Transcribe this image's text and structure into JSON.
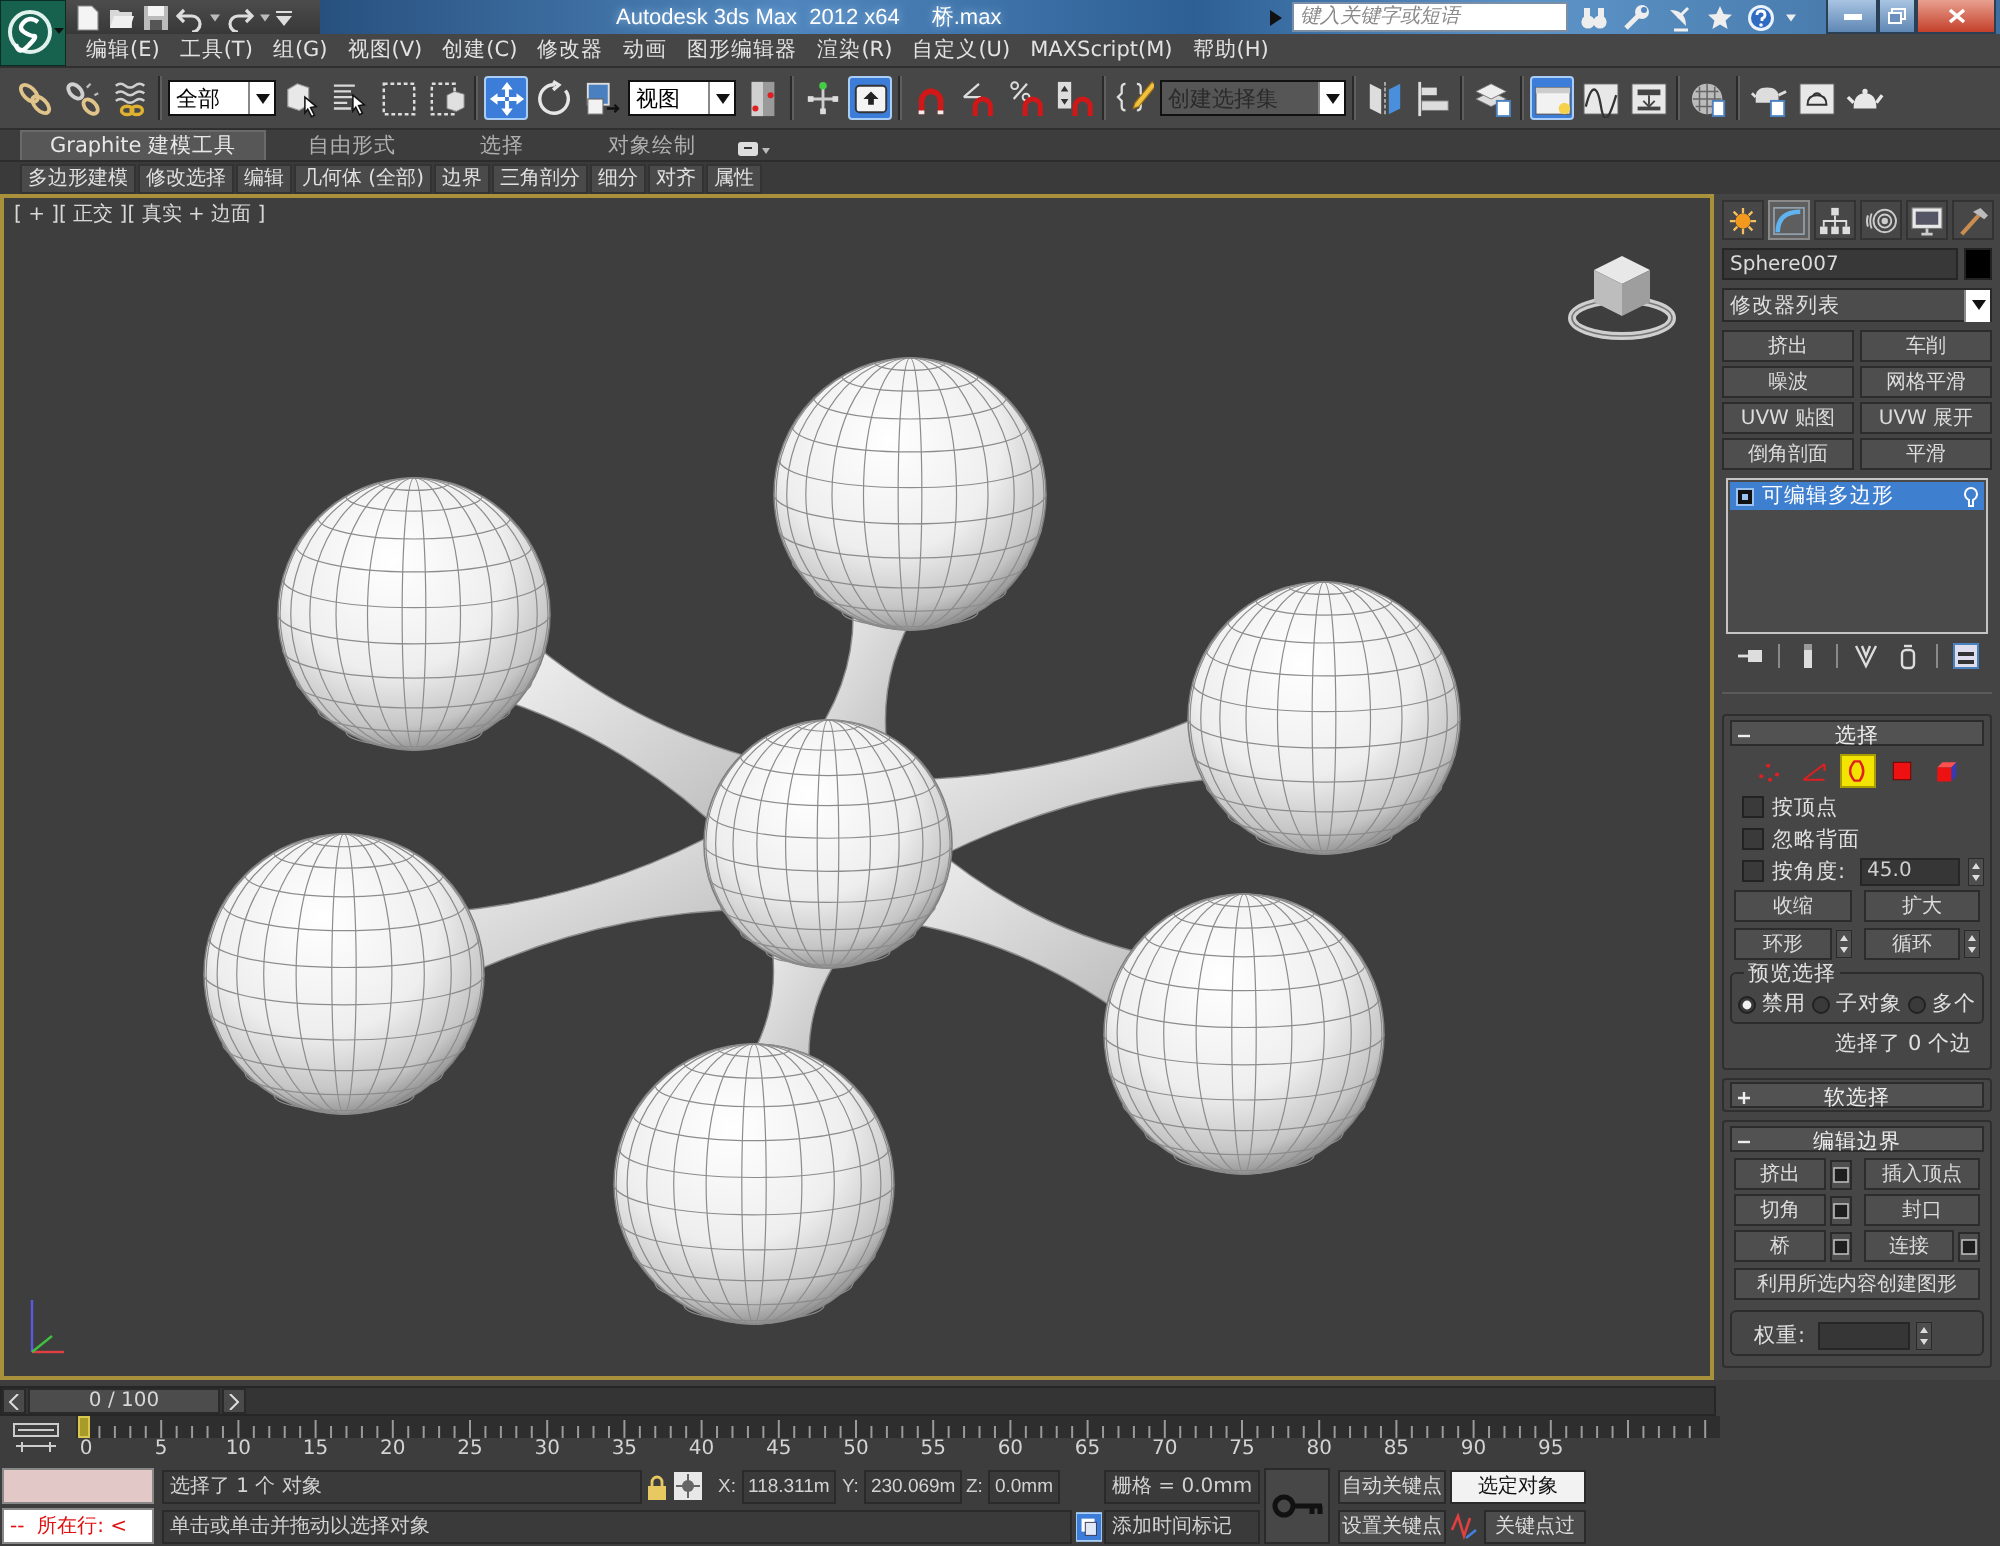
{
  "window": {
    "title": "Autodesk 3ds Max  2012 x64",
    "file": "桥.max"
  },
  "info_center": {
    "placeholder": "键入关键字或短语"
  },
  "menu": [
    "编辑(E)",
    "工具(T)",
    "组(G)",
    "视图(V)",
    "创建(C)",
    "修改器",
    "动画",
    "图形编辑器",
    "渲染(R)",
    "自定义(U)",
    "MAXScript(M)",
    "帮助(H)"
  ],
  "main_toolbar": {
    "groups": [
      {
        "items": [
          {
            "kind": "icon",
            "selected": false
          },
          {
            "kind": "icon",
            "selected": false
          },
          {
            "kind": "icon",
            "selected": false
          }
        ]
      },
      {
        "items": [
          {
            "kind": "dropdown",
            "value": "全部"
          },
          {
            "kind": "icon",
            "selected": false
          },
          {
            "kind": "icon",
            "selected": false
          },
          {
            "kind": "icon",
            "selected": false
          },
          {
            "kind": "icon",
            "selected": false
          }
        ]
      },
      {
        "items": [
          {
            "kind": "icon",
            "selected": true
          },
          {
            "kind": "icon",
            "selected": false
          },
          {
            "kind": "icon",
            "selected": false
          },
          {
            "kind": "dropdown",
            "value": "视图"
          },
          {
            "kind": "icon",
            "selected": false
          }
        ]
      },
      {
        "items": [
          {
            "kind": "icon",
            "selected": false
          },
          {
            "kind": "icon",
            "selected": true
          }
        ]
      },
      {
        "items": [
          {
            "kind": "icon",
            "selected": false
          },
          {
            "kind": "icon",
            "selected": false
          },
          {
            "kind": "icon",
            "selected": false
          },
          {
            "kind": "icon",
            "selected": false
          }
        ]
      },
      {
        "items": [
          {
            "kind": "icon",
            "selected": false
          },
          {
            "kind": "combo",
            "placeholder": "创建选择集"
          }
        ]
      },
      {
        "items": [
          {
            "kind": "icon",
            "selected": false
          },
          {
            "kind": "icon",
            "selected": false
          }
        ]
      },
      {
        "items": [
          {
            "kind": "icon",
            "selected": false
          }
        ]
      },
      {
        "items": [
          {
            "kind": "icon",
            "selected": true
          },
          {
            "kind": "icon",
            "selected": false
          },
          {
            "kind": "icon",
            "selected": false
          }
        ]
      },
      {
        "items": [
          {
            "kind": "icon",
            "selected": false
          }
        ]
      },
      {
        "items": [
          {
            "kind": "icon",
            "selected": false
          },
          {
            "kind": "icon",
            "selected": false
          },
          {
            "kind": "icon",
            "selected": false
          }
        ]
      }
    ]
  },
  "ribbon": {
    "tabs": [
      {
        "label": "Graphite 建模工具",
        "selected": true
      },
      {
        "label": "自由形式",
        "selected": false
      },
      {
        "label": "选择",
        "selected": false
      },
      {
        "label": "对象绘制",
        "selected": false
      }
    ],
    "panels": [
      "多边形建模",
      "修改选择",
      "编辑",
      "几何体 (全部)",
      "边界",
      "三角剖分",
      "细分",
      "对齐",
      "属性"
    ]
  },
  "viewport": {
    "label": "[ + ][ 正交 ][ 真实 + 边面 ]",
    "active": true
  },
  "command_panel": {
    "tabs": [
      {
        "selected": false
      },
      {
        "selected": true
      },
      {
        "selected": false
      },
      {
        "selected": false
      },
      {
        "selected": false
      },
      {
        "selected": false
      }
    ],
    "object_name": "Sphere007",
    "modifier_list": "修改器列表",
    "modifier_buttons": [
      "挤出",
      "车削",
      "噪波",
      "网格平滑",
      "UVW 贴图",
      "UVW 展开",
      "倒角剖面",
      "平滑"
    ],
    "stack": [
      {
        "label": "可编辑多边形",
        "selected": true
      }
    ]
  },
  "selection_rollout": {
    "title": "选择",
    "expanded": true,
    "levels": [
      {
        "selected": false
      },
      {
        "selected": false
      },
      {
        "selected": true
      },
      {
        "selected": false
      },
      {
        "selected": false
      }
    ],
    "options": [
      {
        "kind": "checkbox",
        "label": "按顶点",
        "checked": false
      },
      {
        "kind": "checkbox",
        "label": "忽略背面",
        "checked": false
      },
      {
        "kind": "checkbox_spinner",
        "label": "按角度:",
        "checked": false,
        "value": "45.0"
      }
    ],
    "grow_buttons": [
      "收缩",
      "扩大"
    ],
    "loop_buttons": [
      "环形",
      "循环"
    ],
    "preview": {
      "title": "预览选择",
      "options": [
        {
          "label": "禁用",
          "selected": true
        },
        {
          "label": "子对象",
          "selected": false
        },
        {
          "label": "多个",
          "selected": false
        }
      ]
    },
    "summary": "选择了 0 个边"
  },
  "soft_selection_rollout": {
    "title": "软选择",
    "expanded": false
  },
  "edit_borders_rollout": {
    "title": "编辑边界",
    "expanded": true,
    "buttons": [
      {
        "label": "挤出",
        "settings": true
      },
      {
        "label": "插入顶点",
        "settings": false
      },
      {
        "label": "切角",
        "settings": true
      },
      {
        "label": "封口",
        "settings": false
      },
      {
        "label": "桥",
        "settings": true
      },
      {
        "label": "连接",
        "settings": true
      }
    ],
    "create_shape": "利用所选内容创建图形",
    "weight_label": "权重:"
  },
  "time_slider": {
    "position": "0 / 100",
    "level": 0
  },
  "timeline": {
    "labels": [
      "0",
      "5",
      "10",
      "15",
      "20",
      "25",
      "30",
      "35",
      "40",
      "45",
      "50",
      "55",
      "60",
      "65",
      "70",
      "75",
      "80",
      "85",
      "90",
      "95"
    ]
  },
  "status_bar": {
    "listener_output": "--  所在行: <",
    "selection": "选择了 1 个 对象",
    "prompt": "单击或单击并拖动以选择对象",
    "coords": [
      {
        "axis": "X:",
        "value": "118.311m"
      },
      {
        "axis": "Y:",
        "value": "230.069m"
      },
      {
        "axis": "Z:",
        "value": "0.0mm"
      }
    ],
    "grid": "栅格 = 0.0mm",
    "add_time_tag": "添加时间标记",
    "auto_key": "自动关键点",
    "key_mode": "选定对象",
    "set_key": "设置关键点",
    "key_filters": "关键点过"
  }
}
